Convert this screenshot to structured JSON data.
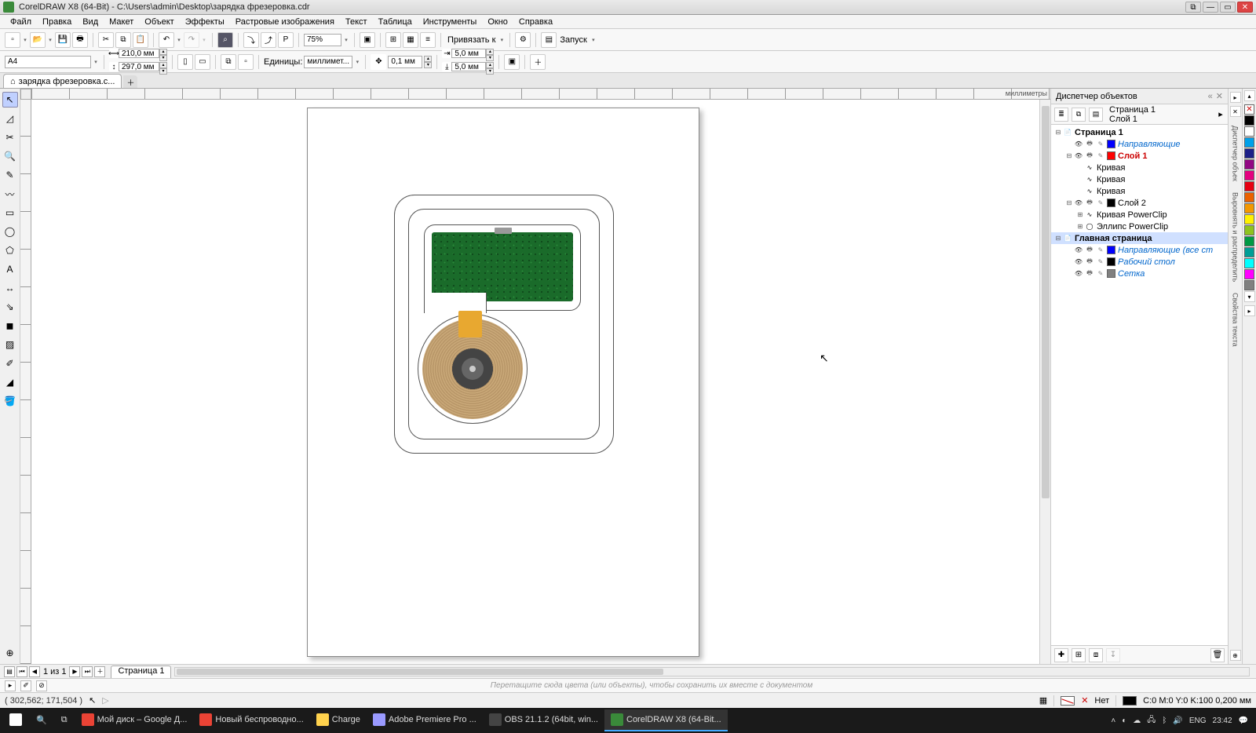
{
  "titlebar": {
    "app": "CorelDRAW X8 (64-Bit)",
    "path": "C:\\Users\\admin\\Desktop\\зарядка фрезеровка.cdr"
  },
  "menu": [
    "Файл",
    "Правка",
    "Вид",
    "Макет",
    "Объект",
    "Эффекты",
    "Растровые изображения",
    "Текст",
    "Таблица",
    "Инструменты",
    "Окно",
    "Справка"
  ],
  "toolbar1": {
    "zoom": "75%",
    "snap": "Привязать к",
    "launch": "Запуск"
  },
  "toolbar2": {
    "page_size": "A4",
    "width": "210,0 мм",
    "height": "297,0 мм",
    "units_label": "Единицы:",
    "units": "миллимет...",
    "nudge": "0,1 мм",
    "dup_x": "5,0 мм",
    "dup_y": "5,0 мм"
  },
  "doc_tab": "зарядка фрезеровка.c...",
  "ruler_unit": "миллиметры",
  "dock": {
    "title": "Диспетчер объектов",
    "header_page": "Страница 1",
    "header_layer": "Слой 1",
    "tree": [
      {
        "d": 0,
        "exp": "-",
        "page": true,
        "label": "Страница 1",
        "bold": true
      },
      {
        "d": 1,
        "exp": "",
        "layer": true,
        "sw": "#0000ff",
        "label": "Направляющие",
        "cls": "blue"
      },
      {
        "d": 1,
        "exp": "-",
        "layer": true,
        "sw": "#ff0000",
        "label": "Слой 1",
        "cls": "red bold"
      },
      {
        "d": 2,
        "obj": "curve",
        "label": "Кривая"
      },
      {
        "d": 2,
        "obj": "curve",
        "label": "Кривая"
      },
      {
        "d": 2,
        "obj": "curve",
        "label": "Кривая"
      },
      {
        "d": 1,
        "exp": "-",
        "layer": true,
        "sw": "#000000",
        "label": "Слой 2"
      },
      {
        "d": 2,
        "exp": "+",
        "obj": "curve",
        "label": "Кривая PowerClip"
      },
      {
        "d": 2,
        "exp": "+",
        "obj": "ellipse",
        "label": "Эллипс PowerClip"
      },
      {
        "d": 0,
        "exp": "-",
        "page": true,
        "label": "Главная страница",
        "bold": true,
        "sel": true
      },
      {
        "d": 1,
        "exp": "",
        "layer": true,
        "sw": "#0000ff",
        "label": "Направляющие (все ст",
        "cls": "blue"
      },
      {
        "d": 1,
        "exp": "",
        "layer": true,
        "sw": "#000000",
        "label": "Рабочий стол",
        "cls": "blue"
      },
      {
        "d": 1,
        "exp": "",
        "layer": true,
        "sw": "#808080",
        "label": "Сетка",
        "cls": "blue"
      }
    ]
  },
  "right_tabs": [
    "Диспетчер объек",
    "Выровнять и распределить",
    "Свойства текста"
  ],
  "colors": [
    "none",
    "#000000",
    "#ffffff",
    "#00a0e9",
    "#1d2088",
    "#920783",
    "#e4007f",
    "#e60012",
    "#eb6100",
    "#f39800",
    "#fff100",
    "#8fc31f",
    "#009944",
    "#009e96",
    "#00ffff",
    "#ff00ff",
    "#808080"
  ],
  "page_nav": {
    "cur": "1",
    "of_label": "из",
    "total": "1",
    "tab": "Страница 1"
  },
  "hint": "Перетащите сюда цвета (или объекты), чтобы сохранить их вместе с документом",
  "status": {
    "coords": "( 302,562; 171,504 )",
    "fill_none": "Нет",
    "outline": "C:0 M:0 Y:0 K:100  0,200 мм"
  },
  "taskbar": {
    "items": [
      {
        "label": "Мой диск – Google Д...",
        "color": "#ea4335"
      },
      {
        "label": "Новый беспроводно...",
        "color": "#ea4335"
      },
      {
        "label": "Charge",
        "color": "#ffd24d"
      },
      {
        "label": "Adobe Premiere Pro ...",
        "color": "#9a9aff"
      },
      {
        "label": "OBS 21.1.2 (64bit, win...",
        "color": "#444"
      },
      {
        "label": "CorelDRAW X8 (64-Bit...",
        "color": "#3a8a3a",
        "active": true
      }
    ],
    "lang": "ENG",
    "time": "23:42"
  }
}
